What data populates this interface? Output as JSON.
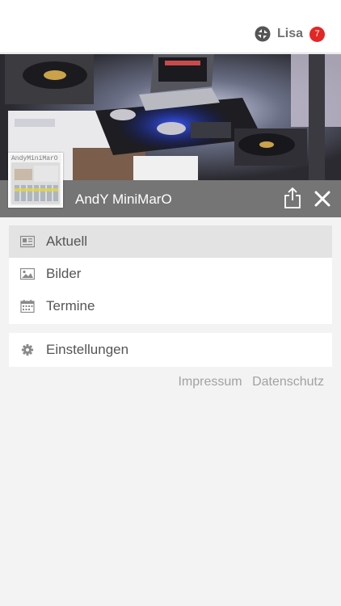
{
  "header": {
    "user_name": "Lisa",
    "notification_count": "7",
    "logo_icon": "app-logo-icon"
  },
  "banner": {
    "description_icon": "dj-setup-photo"
  },
  "profile": {
    "avatar_caption": "AndyMiniMarO",
    "name": "AndY MiniMarO",
    "share_icon": "share-icon",
    "close_icon": "close-icon"
  },
  "menu": {
    "items": [
      {
        "label": "Aktuell",
        "icon": "newspaper-icon",
        "active": true
      },
      {
        "label": "Bilder",
        "icon": "image-icon",
        "active": false
      },
      {
        "label": "Termine",
        "icon": "calendar-icon",
        "active": false
      }
    ],
    "settings": {
      "label": "Einstellungen",
      "icon": "gear-icon"
    }
  },
  "footer": {
    "impressum": "Impressum",
    "datenschutz": "Datenschutz"
  },
  "colors": {
    "badge": "#e32626",
    "profile_bar": "#757575",
    "active_item": "#e3e3e3"
  }
}
